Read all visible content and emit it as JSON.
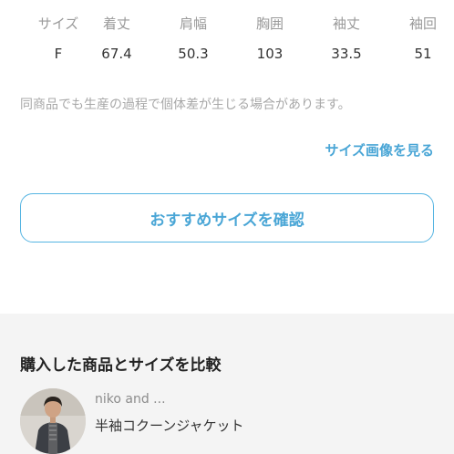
{
  "size_table": {
    "headers": [
      "サイズ",
      "着丈",
      "肩幅",
      "胸囲",
      "袖丈",
      "袖回"
    ],
    "values": [
      "F",
      "67.4",
      "50.3",
      "103",
      "33.5",
      "51"
    ]
  },
  "note": "同商品でも生産の過程で個体差が生じる場合があります。",
  "view_size_image_link": "サイズ画像を見る",
  "recommend_button": "おすすめサイズを確認",
  "compare": {
    "title": "購入した商品とサイズを比較",
    "product": {
      "brand": "niko and ...",
      "name": "半袖コクーンジャケット"
    }
  },
  "colors": {
    "accent": "#4aa6d6",
    "muted_text": "#9a9a9a",
    "section_bg": "#f4f4f4"
  }
}
